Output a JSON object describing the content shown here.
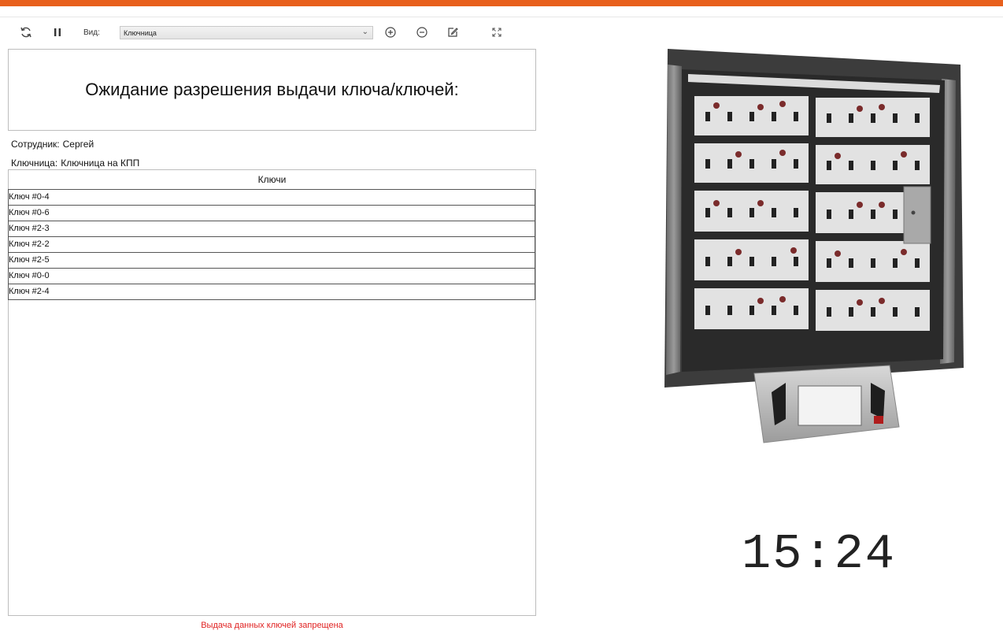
{
  "toolbar": {
    "view_label": "Вид:",
    "view_select_value": "Ключница",
    "icons": [
      "refresh-icon",
      "pause-icon",
      "zoom-in-icon",
      "zoom-out-icon",
      "edit-icon",
      "fullscreen-icon"
    ]
  },
  "title": "Ожидание разрешения выдачи ключа/ключей:",
  "employee": {
    "label": "Сотрудник:",
    "value": "Сергей"
  },
  "keybox": {
    "label": "Ключница:",
    "value": "Ключница на КПП"
  },
  "keys_table": {
    "header": "Ключи",
    "rows": [
      "Ключ #0-4",
      "Ключ #0-6",
      "Ключ #2-3",
      "Ключ #2-2",
      "Ключ #2-5",
      "Ключ #0-0",
      "Ключ #2-4"
    ]
  },
  "status_message": "Выдача данных ключей запрещена",
  "clock": "15:24",
  "colors": {
    "accent": "#e8601c",
    "error": "#e02222"
  }
}
